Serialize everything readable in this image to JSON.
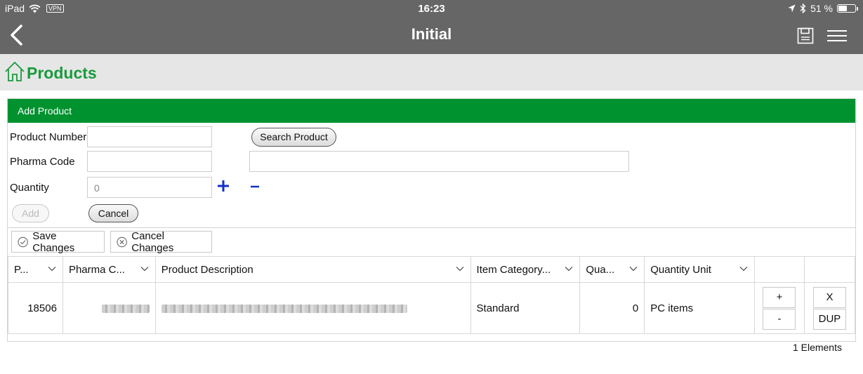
{
  "status_bar": {
    "device": "iPad",
    "vpn": "VPN",
    "time": "16:23",
    "battery": "51 %",
    "battery_level": 0.51
  },
  "nav": {
    "title": "Initial"
  },
  "page": {
    "title": "Products"
  },
  "add_product": {
    "header": "Add Product",
    "product_number_label": "Product Number",
    "product_number_value": "",
    "pharma_code_label": "Pharma Code",
    "pharma_code_value": "",
    "quantity_label": "Quantity",
    "quantity_placeholder": "0",
    "description_value": "",
    "search_button": "Search Product",
    "add_button": "Add",
    "cancel_button": "Cancel"
  },
  "toolbar": {
    "save_changes": "Save Changes",
    "cancel_changes": "Cancel Changes"
  },
  "table": {
    "columns": [
      "P...",
      "Pharma C...",
      "Product Description",
      "Item Category...",
      "Qua...",
      "Quantity Unit",
      "",
      ""
    ],
    "rows": [
      {
        "product_number": "18506",
        "pharma_code": "",
        "description": "",
        "item_category": "Standard",
        "quantity": "0",
        "quantity_unit": "PC items",
        "plus": "+",
        "minus": "-",
        "delete": "X",
        "duplicate": "DUP"
      }
    ]
  },
  "footer": {
    "count": "1 Elements"
  }
}
